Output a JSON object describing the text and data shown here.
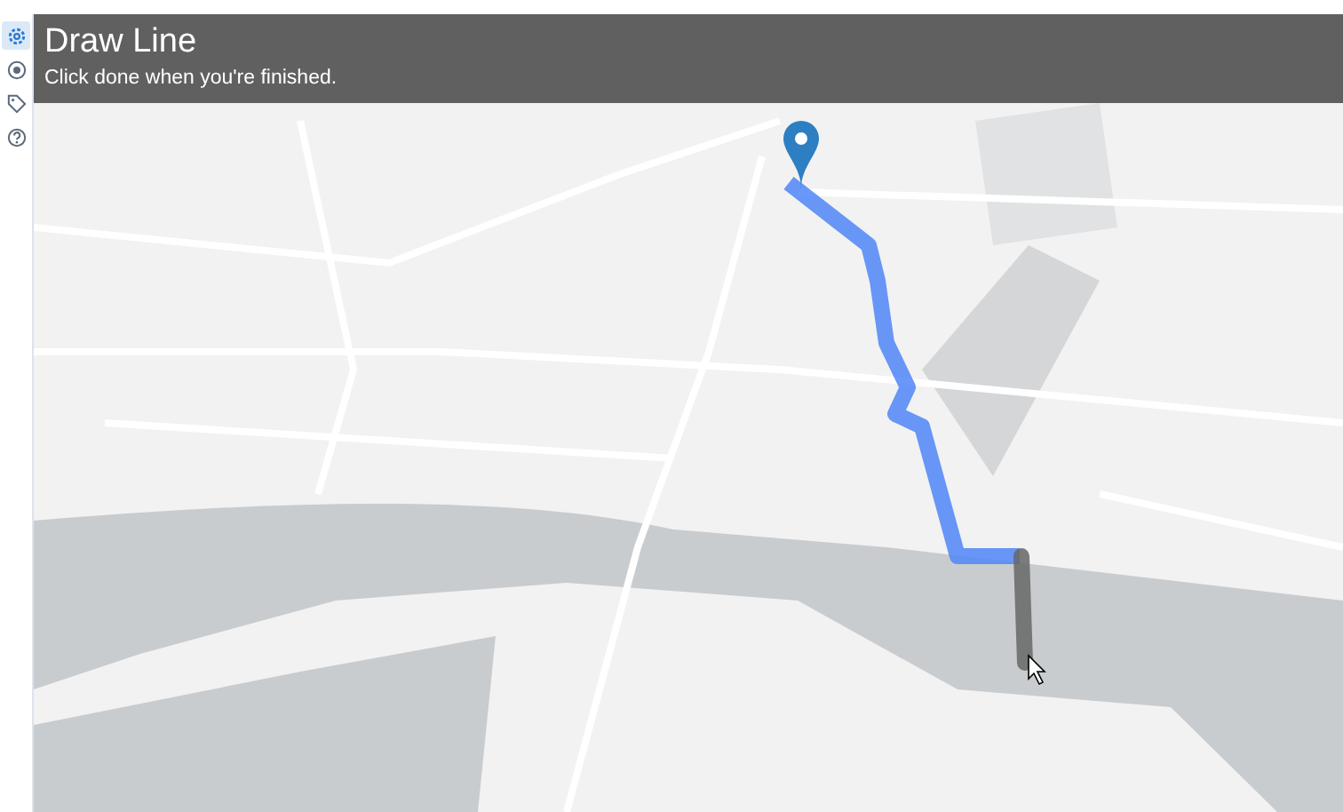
{
  "sidebar": {
    "items": [
      {
        "kind": "gear",
        "selected": true
      },
      {
        "kind": "target",
        "selected": false
      },
      {
        "kind": "tag",
        "selected": false
      },
      {
        "kind": "help",
        "selected": false
      }
    ]
  },
  "banner": {
    "title": "Draw Line",
    "subtitle": "Click done when you're finished."
  }
}
